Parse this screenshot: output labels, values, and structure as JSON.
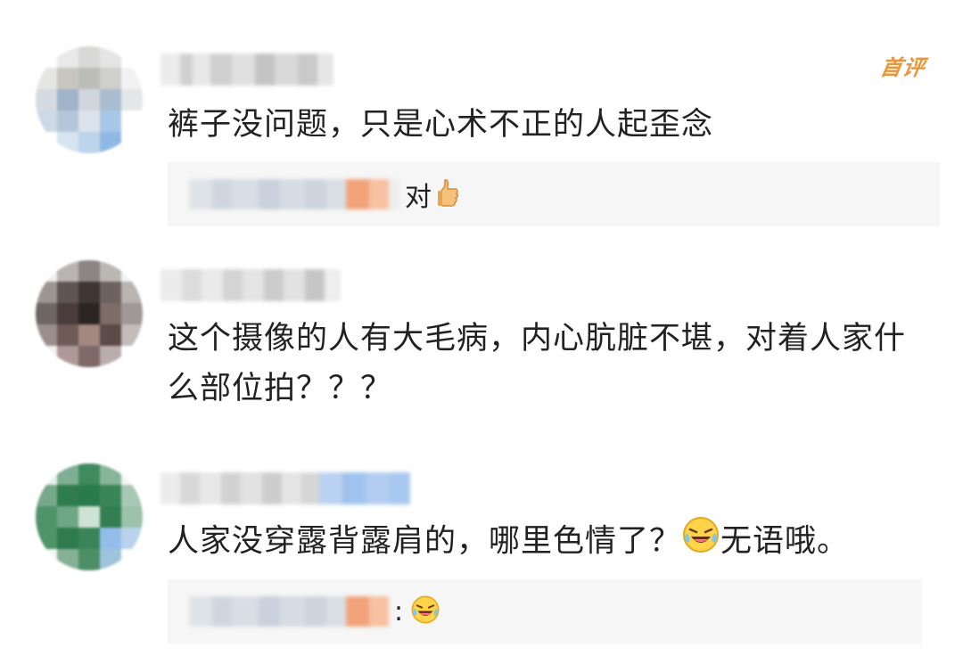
{
  "comments": [
    {
      "badge": "首评",
      "text": "裤子没问题，只是心术不正的人起歪念",
      "reply": {
        "text": "对"
      }
    },
    {
      "text": "这个摄像的人有大毛病，内心肮脏不堪，对着人家什么部位拍？？？"
    },
    {
      "text_before_emoji": "人家没穿露背露肩的，哪里色情了？",
      "text_after_emoji": "无语哦。",
      "reply": {
        "separator": ":"
      }
    }
  ],
  "icons": {
    "first_reply_icon": "thumbs-up-icon",
    "laugh_cry_icon": "laugh-cry-emoji-icon"
  },
  "colors": {
    "badge": "#e8963a",
    "reply_bg": "#f6f6f6"
  }
}
